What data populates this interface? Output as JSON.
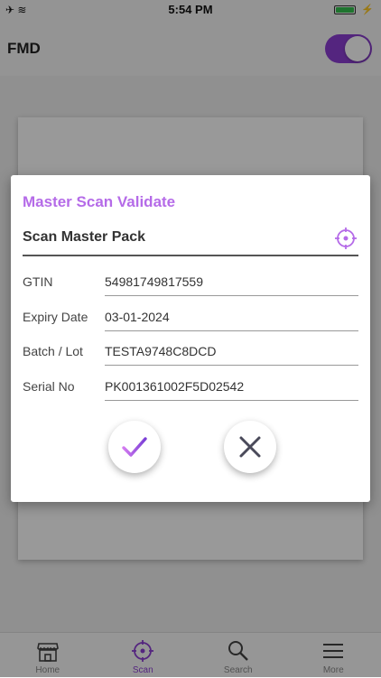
{
  "status_bar": {
    "time": "5:54 PM"
  },
  "header": {
    "title": "FMD"
  },
  "tabs": [
    {
      "label": "Home",
      "icon": "home-icon",
      "active": false
    },
    {
      "label": "Scan",
      "icon": "target-icon",
      "active": true
    },
    {
      "label": "Search",
      "icon": "search-icon",
      "active": false
    },
    {
      "label": "More",
      "icon": "menu-icon",
      "active": false
    }
  ],
  "dialog": {
    "title": "Master Scan Validate",
    "scan_label": "Scan Master Pack",
    "fields": [
      {
        "label": "GTIN",
        "value": "54981749817559"
      },
      {
        "label": "Expiry Date",
        "value": "03-01-2024"
      },
      {
        "label": "Batch / Lot",
        "value": "TESTA9748C8DCD"
      },
      {
        "label": "Serial No",
        "value": "PK001361002F5D02542"
      }
    ]
  },
  "colors": {
    "accent": "#8d3fd4",
    "title": "#b56be8"
  }
}
